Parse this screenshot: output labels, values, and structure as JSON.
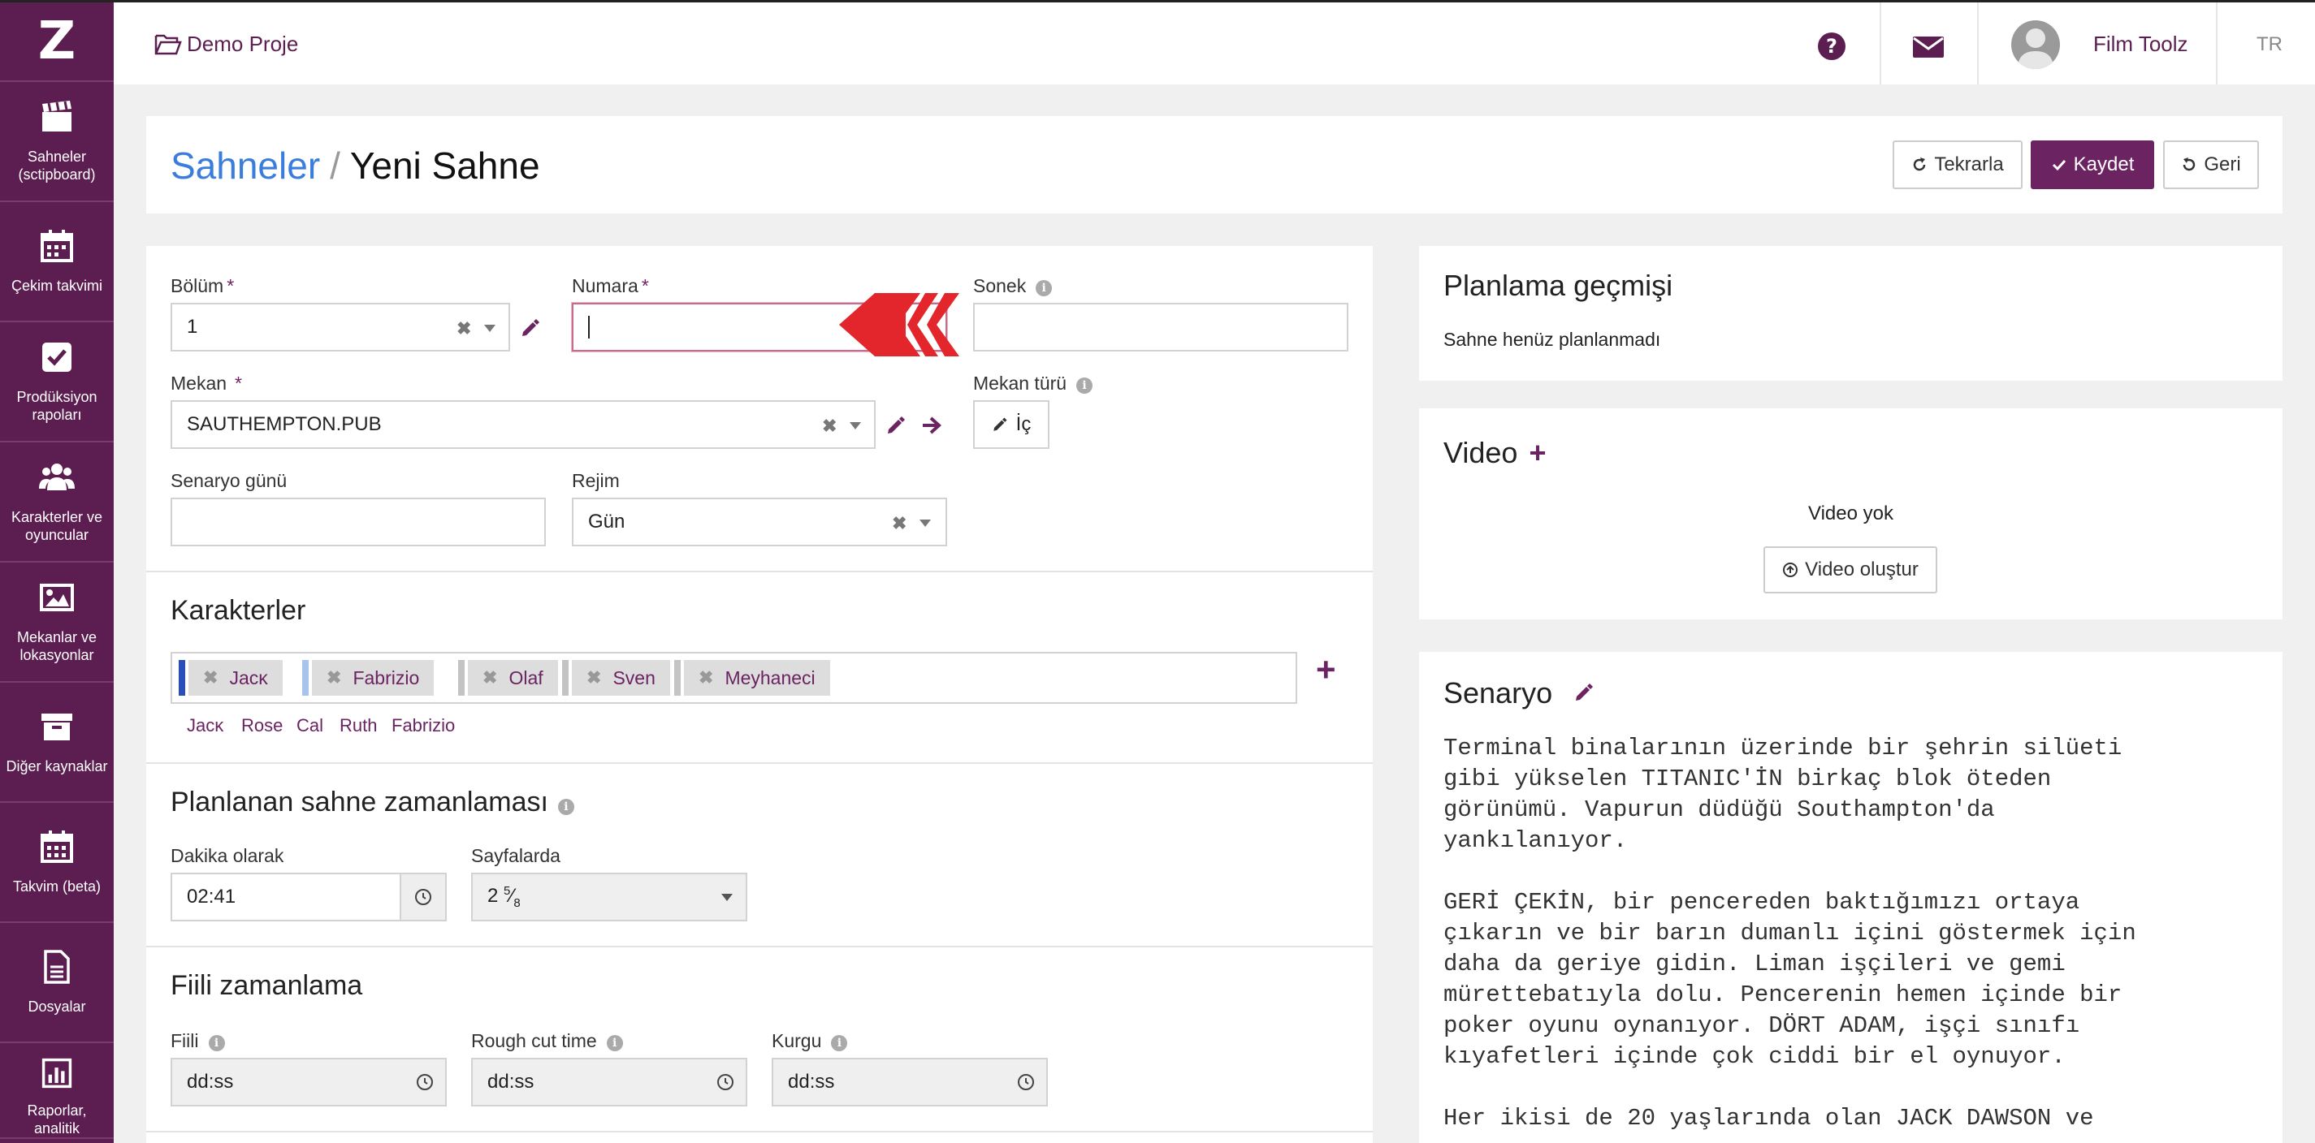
{
  "sidebar": {
    "logo": "Z",
    "items": [
      {
        "label": "Sahneler (sctipboard)",
        "icon": "clapperboard-icon"
      },
      {
        "label": "Çekim takvimi",
        "icon": "calendar-icon"
      },
      {
        "label": "Prodüksiyon rapoları",
        "icon": "checkbox-icon"
      },
      {
        "label": "Karakterler ve oyuncular",
        "icon": "users-icon"
      },
      {
        "label": "Mekanlar ve lokasyonlar",
        "icon": "image-icon"
      },
      {
        "label": "Diğer kaynaklar",
        "icon": "archive-icon"
      },
      {
        "label": "Takvim (beta)",
        "icon": "calendar-grid-icon"
      },
      {
        "label": "Dosyalar",
        "icon": "file-icon"
      },
      {
        "label": "Raporlar, analitik",
        "icon": "bar-chart-icon"
      }
    ]
  },
  "topbar": {
    "project": "Demo Proje",
    "user": "Film Toolz",
    "lang": "TR"
  },
  "header": {
    "crumb_link": "Sahneler",
    "crumb_sep": "/",
    "title": "Yeni Sahne",
    "repeat_label": "Tekrarla",
    "save_label": "Kaydet",
    "back_label": "Geri"
  },
  "form": {
    "bolum": {
      "label": "Bölüm",
      "value": "1"
    },
    "numara": {
      "label": "Numara",
      "value": ""
    },
    "sonek": {
      "label": "Sonek",
      "value": ""
    },
    "mekan": {
      "label": "Mekan",
      "value": "SAUTHEMPTON.PUB"
    },
    "mekan_turu": {
      "label": "Mekan türü",
      "value": "İç"
    },
    "senaryo_gunu": {
      "label": "Senaryo günü",
      "value": ""
    },
    "rejim": {
      "label": "Rejim",
      "value": "Gün"
    },
    "required_mark": "*",
    "info_mark": "i"
  },
  "characters": {
    "title": "Karakterler",
    "tags": [
      {
        "name": "Jacĸ",
        "color": "#2a4fb8"
      },
      {
        "name": "Fabrizio",
        "color": "#a8c4ec"
      },
      {
        "name": "Olaf",
        "color": "#c4c4c4"
      },
      {
        "name": "Sven",
        "color": "#c4c4c4"
      },
      {
        "name": "Meyhaneci",
        "color": "#c4c4c4"
      }
    ],
    "suggestions": [
      "Jacĸ",
      "Rose",
      "Cal",
      "Ruth",
      "Fabrizio"
    ],
    "remove_mark": "✖",
    "add_mark": "+"
  },
  "planned": {
    "title": "Planlanan sahne zamanlaması",
    "minutes_label": "Dakika olarak",
    "minutes_value": "02:41",
    "pages_label": "Sayfalarda",
    "pages_whole": "2",
    "pages_num": "5",
    "pages_slash": "⁄",
    "pages_den": "8"
  },
  "actual": {
    "title": "Fiili zamanlama",
    "fiili_label": "Fiili",
    "fiili_placeholder": "dd:ss",
    "rough_label": "Rough cut time",
    "rough_placeholder": "dd:ss",
    "kurgu_label": "Kurgu",
    "kurgu_placeholder": "dd:ss"
  },
  "planning_history": {
    "title": "Planlama geçmişi",
    "text": "Sahne henüz planlanmadı"
  },
  "video": {
    "title": "Video",
    "add_mark": "+",
    "empty": "Video yok",
    "create_label": "Video oluştur"
  },
  "scenario": {
    "title": "Senaryo",
    "text": "Terminal binalarının üzerinde bir şehrin silüeti\ngibi yükselen TITANIC'İN birkaç blok öteden\ngörünümü. Vapurun düdüğü Southampton'da\nyankılanıyor.\n\nGERİ ÇEKİN, bir pencereden baktığımızı ortaya\nçıkarın ve bir barın dumanlı içini göstermek için\ndaha da geriye gidin. Liman işçileri ve gemi\nmürettebatıyla dolu. Pencerenin hemen içinde bir\npoker oyunu oynanıyor. DÖRT ADAM, işçi sınıfı\nkıyafetleri içinde çok ciddi bir el oynuyor.\n\nHer ikisi de 20 yaşlarında olan JACK DAWSON ve"
  },
  "colors": {
    "brand": "#5c1d50",
    "primary_button": "#6b2362",
    "link": "#3b7ddd",
    "arrow": "#e3262b"
  }
}
